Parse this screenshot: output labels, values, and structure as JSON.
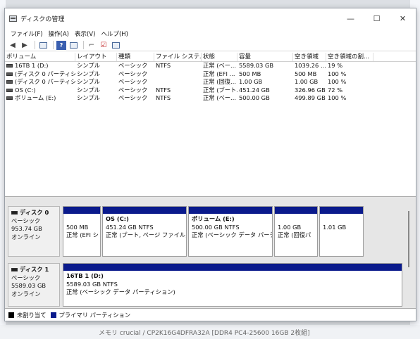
{
  "window": {
    "title": "ディスクの管理"
  },
  "controls": {
    "minimize": "—",
    "maximize": "☐",
    "close": "✕"
  },
  "menu": [
    "ファイル(F)",
    "操作(A)",
    "表示(V)",
    "ヘルプ(H)"
  ],
  "volume_table": {
    "headers": [
      "ボリューム",
      "レイアウト",
      "種類",
      "ファイル システム",
      "状態",
      "容量",
      "空き領域",
      "空き領域の割..."
    ],
    "rows": [
      [
        "16TB 1 (D:)",
        "シンプル",
        "ベーシック",
        "NTFS",
        "正常 (ベー...",
        "5589.03 GB",
        "1039.26 ...",
        "19 %"
      ],
      [
        "(ディスク 0 パーティシ...",
        "シンプル",
        "ベーシック",
        "",
        "正常 (EFI ...",
        "500 MB",
        "500 MB",
        "100 %"
      ],
      [
        "(ディスク 0 パーティシ...",
        "シンプル",
        "ベーシック",
        "",
        "正常 (回復...",
        "1.00 GB",
        "1.00 GB",
        "100 %"
      ],
      [
        "OS (C:)",
        "シンプル",
        "ベーシック",
        "NTFS",
        "正常 (ブート...",
        "451.24 GB",
        "326.96 GB",
        "72 %"
      ],
      [
        "ボリューム (E:)",
        "シンプル",
        "ベーシック",
        "NTFS",
        "正常 (ベー...",
        "500.00 GB",
        "499.89 GB",
        "100 %"
      ]
    ]
  },
  "disk0": {
    "name": "ディスク 0",
    "type": "ベーシック",
    "size": "953.74 GB",
    "status": "オンライン",
    "partitions": [
      {
        "name": "",
        "size": "500 MB",
        "status": "正常 (EFI シ"
      },
      {
        "name": "OS  (C:)",
        "size": "451.24 GB NTFS",
        "status": "正常 (ブート, ページ ファイル, ク"
      },
      {
        "name": "ボリューム  (E:)",
        "size": "500.00 GB NTFS",
        "status": "正常 (ベーシック データ パーティ"
      },
      {
        "name": "",
        "size": "1.00 GB",
        "status": "正常 (回復パ"
      },
      {
        "name": "",
        "size": "1.01 GB",
        "status": ""
      }
    ]
  },
  "disk1": {
    "name": "ディスク 1",
    "type": "ベーシック",
    "size": "5589.03 GB",
    "status": "オンライン",
    "partitions": [
      {
        "name": "16TB 1  (D:)",
        "size": "5589.03 GB NTFS",
        "status": "正常 (ベーシック データ パーティション)"
      }
    ]
  },
  "legend": [
    {
      "label": "未割り当て",
      "color": "#000000"
    },
    {
      "label": "プライマリ パーティション",
      "color": "#0a1a8c"
    }
  ],
  "background": {
    "bottom_text": "メモリ crucial / CP2K16G4DFRA32A [DDR4 PC4-25600 16GB 2枚組]"
  }
}
